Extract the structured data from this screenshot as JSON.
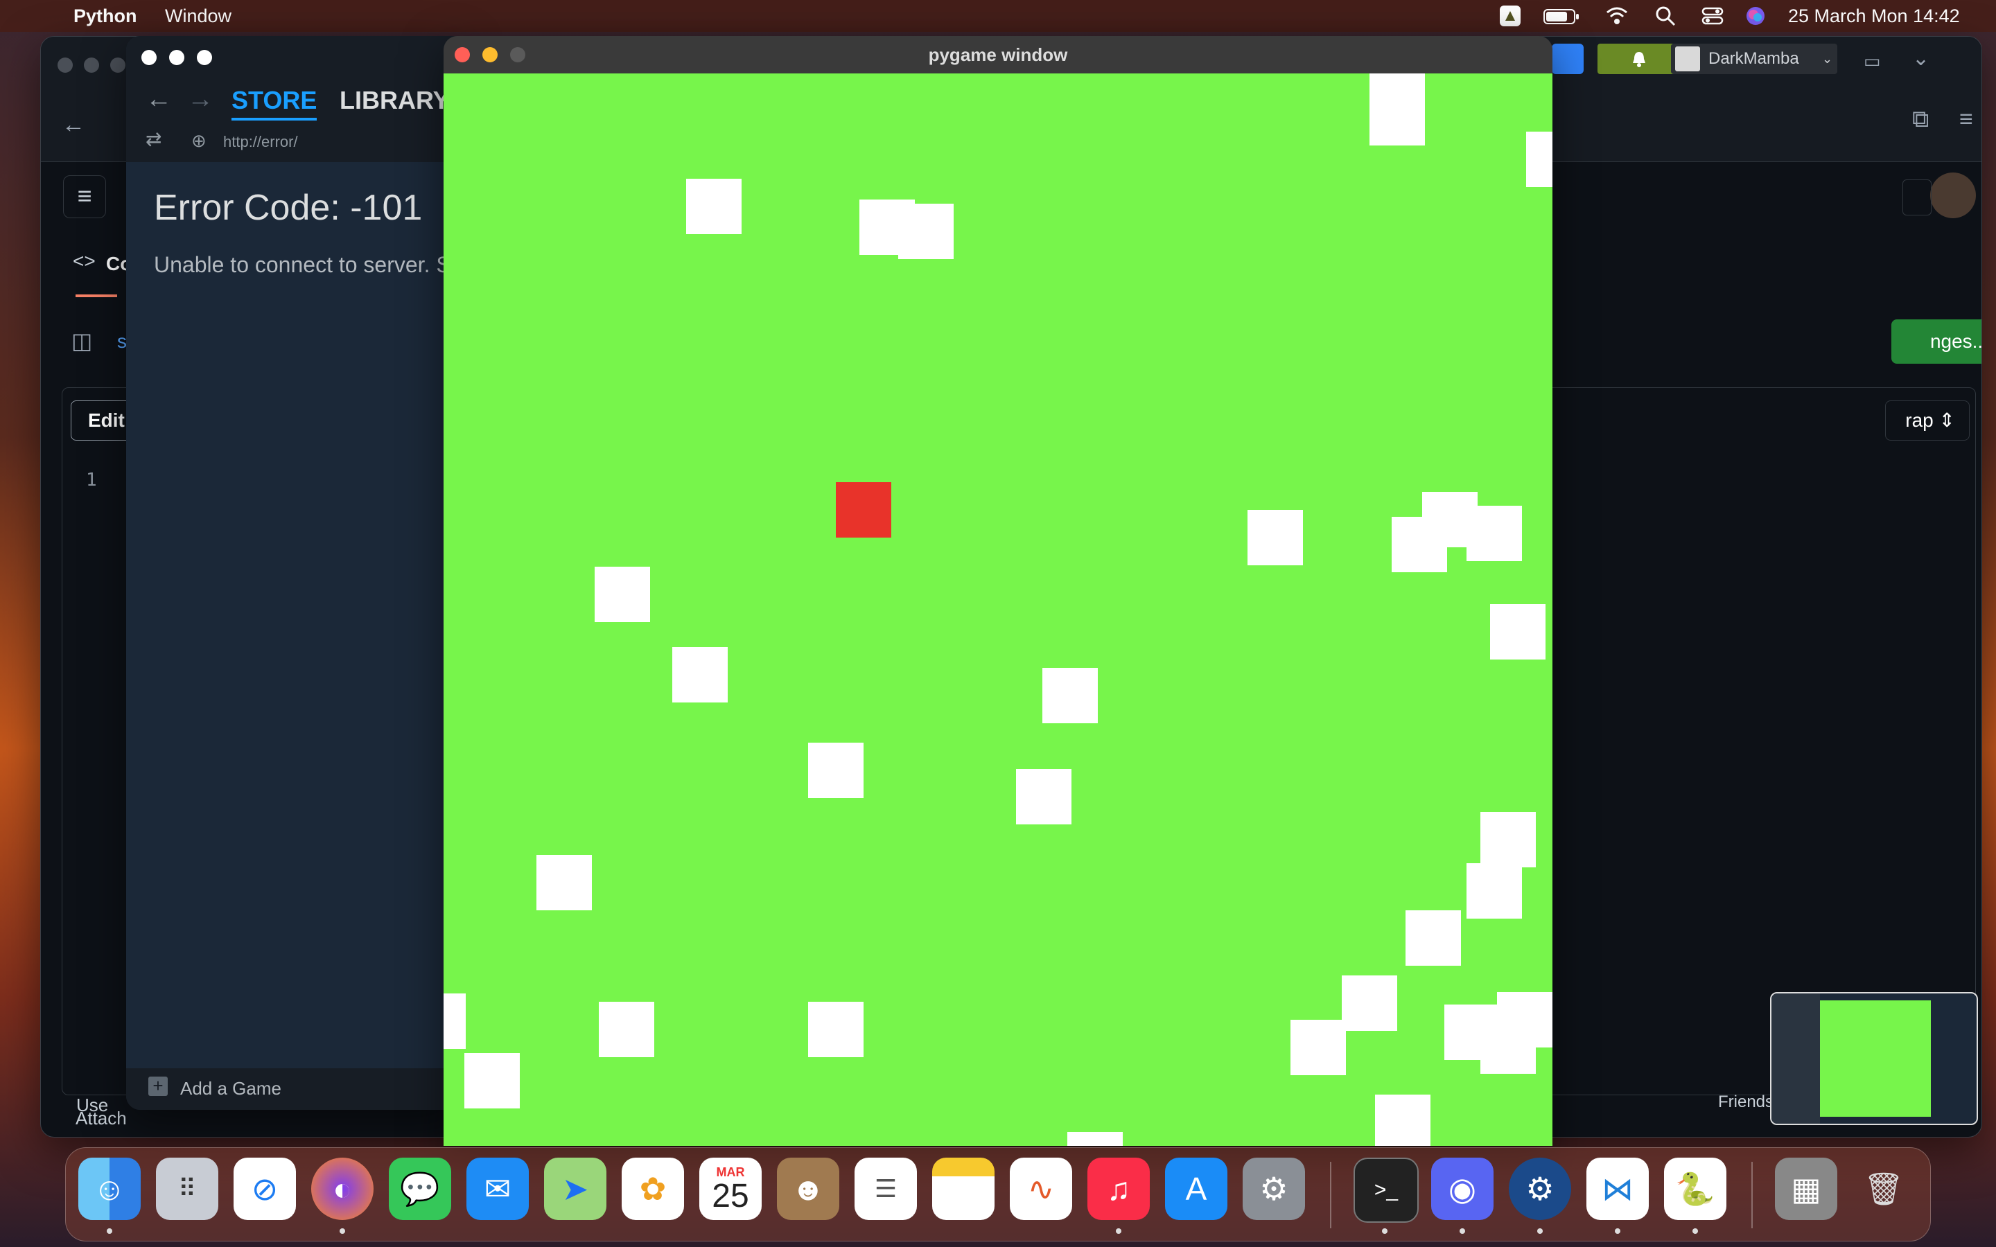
{
  "menubar": {
    "app": "Python",
    "menu_window": "Window",
    "clock": "25 March Mon  14:42"
  },
  "github": {
    "user": "DarkMamba",
    "tab_code": "Co",
    "panel_sub": "s",
    "edit_label": "Edit",
    "line_number": "1",
    "wrap_label": "rap",
    "changes_label": "nges...",
    "use_label": "Use",
    "attach_label": "Attach",
    "friends_label": "Friends"
  },
  "steam": {
    "nav_store": "STORE",
    "nav_library": "LIBRARY",
    "url": "http://error/",
    "error_title": "Error Code: -101",
    "error_msg": "Unable to connect to server. S",
    "add_game": "Add a Game"
  },
  "pygame": {
    "title": "pygame window",
    "colors": {
      "background": "#77f54b",
      "player": "#e8332a",
      "obstacle": "#ffffff"
    }
  },
  "dock": {
    "calendar_month": "MAR",
    "calendar_day": "25",
    "apps": [
      "finder-icon",
      "launchpad-icon",
      "safari-icon",
      "firefox-icon",
      "messages-icon",
      "mail-icon",
      "maps-icon",
      "photos-icon",
      "calendar-icon",
      "contacts-icon",
      "reminders-icon",
      "notes-icon",
      "freeform-icon",
      "music-icon",
      "app-store-icon",
      "system-settings-icon",
      "terminal-icon",
      "discord-icon",
      "steam-icon",
      "vscode-icon",
      "python-launcher-icon",
      "downloads-icon",
      "trash-icon"
    ]
  }
}
